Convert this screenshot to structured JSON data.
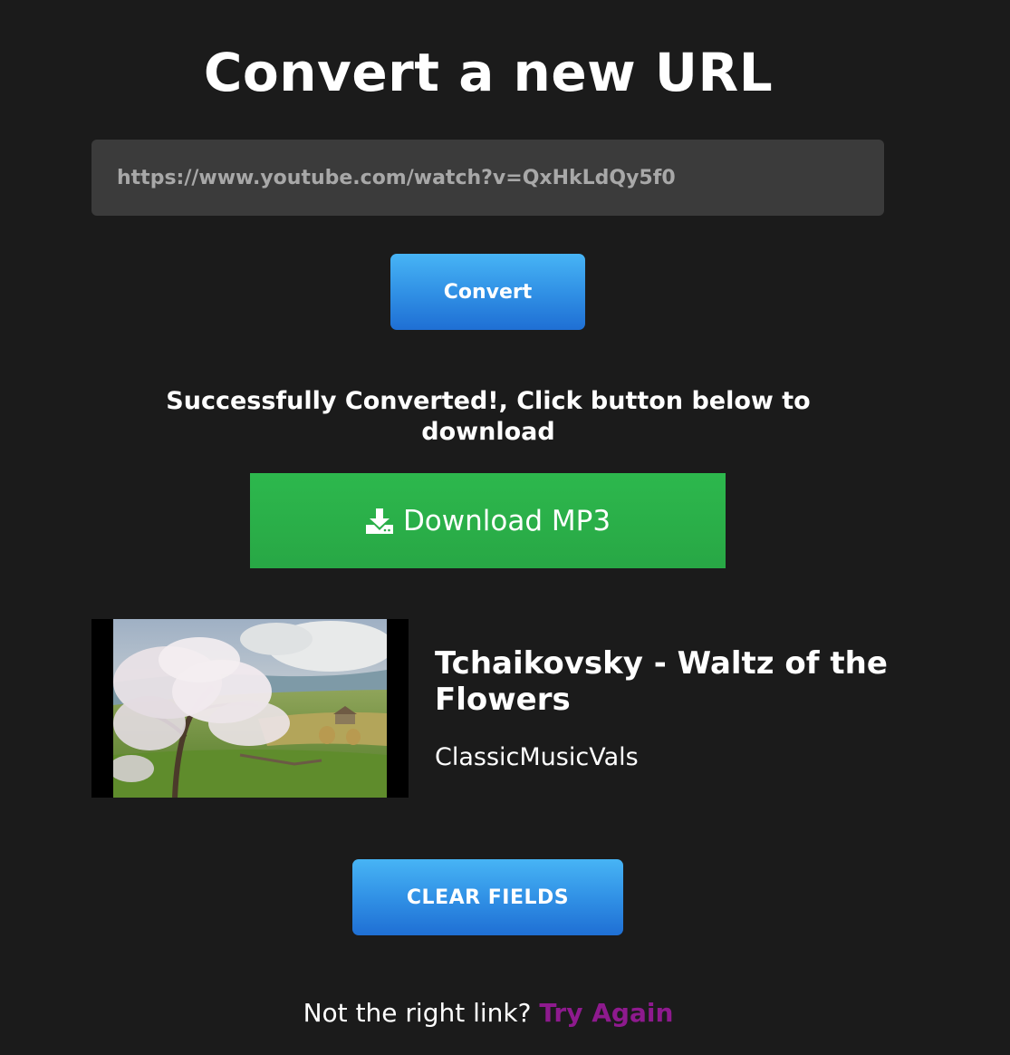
{
  "page": {
    "title": "Convert a new URL"
  },
  "url_input": {
    "value": "https://www.youtube.com/watch?v=QxHkLdQy5f0"
  },
  "convert_button": {
    "label": "Convert"
  },
  "success": {
    "message": "Successfully Converted!, Click button below to download"
  },
  "download_button": {
    "icon": "download-icon",
    "label": "Download MP3"
  },
  "video": {
    "title": "Tchaikovsky - Waltz of the Flowers",
    "channel": "ClassicMusicVals"
  },
  "clear_button": {
    "label": "CLEAR FIELDS"
  },
  "retry": {
    "prompt": "Not the right link?",
    "link_label": "Try Again"
  },
  "colors": {
    "background": "#1b1b1b",
    "input_background": "#3b3b3b",
    "blue_button": "#2f8ee4",
    "green_button": "#28a745",
    "link": "#8e1a8e"
  }
}
